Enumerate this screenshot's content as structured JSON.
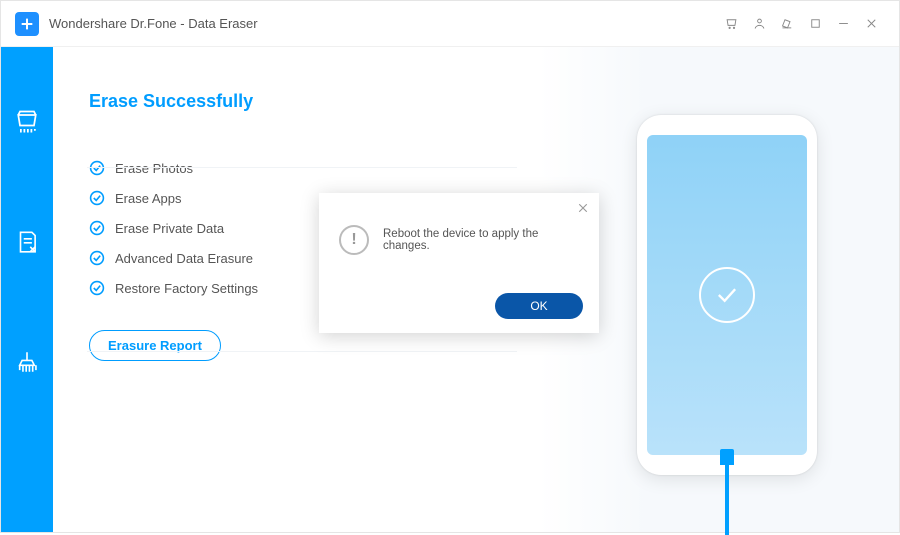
{
  "window": {
    "title": "Wondershare Dr.Fone - Data Eraser"
  },
  "page": {
    "heading": "Erase Successfully",
    "items": [
      "Erase Photos",
      "Erase Apps",
      "Erase Private Data",
      "Advanced Data Erasure",
      "Restore Factory Settings"
    ],
    "report_button": "Erasure Report"
  },
  "dialog": {
    "message": "Reboot the device to apply the changes.",
    "ok": "OK"
  }
}
